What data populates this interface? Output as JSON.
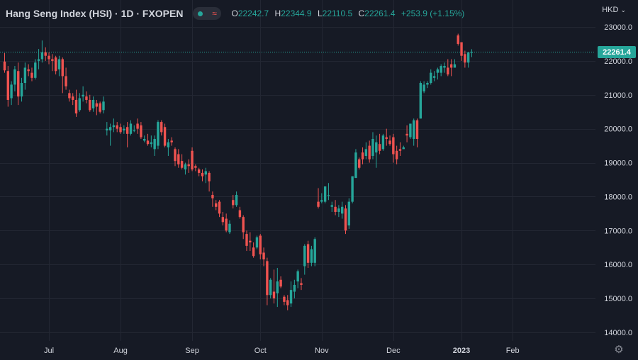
{
  "header": {
    "title": "Hang Seng Index (HSI) · 1D · FXOPEN",
    "ohlc": {
      "open_label": "O",
      "open": "22242.7",
      "high_label": "H",
      "high": "22344.9",
      "low_label": "L",
      "low": "22110.5",
      "close_label": "C",
      "close": "22261.4",
      "change": "+253.9 (+1.15%)"
    },
    "icons": {
      "indicator": "dot-icon",
      "compare": "wave-icon"
    }
  },
  "currency": {
    "label": "HKD",
    "icon": "chevron-down-icon"
  },
  "last_price_tag": "22261.4",
  "settings_icon": "gear-icon",
  "colors": {
    "up": "#26a69a",
    "down": "#ef5350",
    "background": "#161a25",
    "grid": "#232733",
    "axis_text": "#d1d4dc"
  },
  "chart_data": {
    "type": "candlestick",
    "x_ticks": [
      {
        "label": "Jul",
        "index": 13
      },
      {
        "label": "Aug",
        "index": 34
      },
      {
        "label": "Sep",
        "index": 55
      },
      {
        "label": "Oct",
        "index": 75
      },
      {
        "label": "Nov",
        "index": 93
      },
      {
        "label": "Dec",
        "index": 114
      },
      {
        "label": "2023",
        "index": 134
      },
      {
        "label": "Feb",
        "index": 149
      }
    ],
    "y_ticks": [
      14000,
      15000,
      16000,
      17000,
      18000,
      19000,
      20000,
      21000,
      22000,
      23000
    ],
    "ylim": [
      13800,
      23500
    ],
    "last_price": 22261.4,
    "grid": true,
    "candles": [
      [
        21980,
        22230,
        21650,
        21720
      ],
      [
        21700,
        21850,
        20650,
        20850
      ],
      [
        20900,
        21400,
        20700,
        21300
      ],
      [
        21300,
        21850,
        21100,
        21750
      ],
      [
        21700,
        21950,
        20700,
        20950
      ],
      [
        20950,
        21500,
        20800,
        21350
      ],
      [
        21350,
        21950,
        21150,
        21800
      ],
      [
        21750,
        21900,
        21550,
        21700
      ],
      [
        21650,
        21800,
        21400,
        21500
      ],
      [
        21500,
        22050,
        21450,
        21950
      ],
      [
        22000,
        22350,
        21750,
        22050
      ],
      [
        22050,
        22600,
        21950,
        22250
      ],
      [
        22250,
        22400,
        22000,
        22150
      ],
      [
        22150,
        22250,
        21900,
        22050
      ],
      [
        22050,
        22200,
        21700,
        22000
      ],
      [
        22100,
        22150,
        21600,
        21700
      ],
      [
        21750,
        22150,
        21550,
        22050
      ],
      [
        22050,
        22100,
        21050,
        21550
      ],
      [
        21550,
        21800,
        21150,
        21250
      ],
      [
        21050,
        21150,
        20800,
        20900
      ],
      [
        20950,
        21050,
        20700,
        20850
      ],
      [
        20850,
        21150,
        20350,
        20450
      ],
      [
        20550,
        21050,
        20500,
        20900
      ],
      [
        20950,
        21250,
        20800,
        21000
      ],
      [
        20950,
        21100,
        20750,
        20850
      ],
      [
        20850,
        21000,
        20500,
        20550
      ],
      [
        20600,
        20950,
        20500,
        20850
      ],
      [
        20750,
        20850,
        20400,
        20650
      ],
      [
        20750,
        20800,
        20450,
        20500
      ],
      [
        20550,
        20950,
        20450,
        20800
      ],
      [
        19950,
        20200,
        19800,
        20000
      ],
      [
        19950,
        20150,
        19500,
        20050
      ],
      [
        20050,
        20300,
        19900,
        20100
      ],
      [
        20100,
        20200,
        19900,
        20000
      ],
      [
        20050,
        20150,
        19850,
        19900
      ],
      [
        19950,
        20100,
        19850,
        20000
      ],
      [
        20050,
        20200,
        19450,
        19850
      ],
      [
        19850,
        20250,
        19800,
        20150
      ],
      [
        19950,
        20100,
        19900,
        19950
      ],
      [
        20150,
        20300,
        19850,
        20000
      ],
      [
        20100,
        20200,
        19700,
        19750
      ],
      [
        19650,
        19800,
        19600,
        19700
      ],
      [
        19650,
        19850,
        19500,
        19550
      ],
      [
        19550,
        19800,
        19450,
        19600
      ],
      [
        19400,
        19800,
        19200,
        19700
      ],
      [
        19500,
        20250,
        19400,
        20200
      ],
      [
        20200,
        20250,
        19800,
        19900
      ],
      [
        20050,
        20150,
        19450,
        19500
      ],
      [
        19450,
        19700,
        19200,
        19600
      ],
      [
        19650,
        19750,
        19500,
        19600
      ],
      [
        19400,
        19450,
        18900,
        19050
      ],
      [
        19250,
        19400,
        18850,
        18950
      ],
      [
        19050,
        19250,
        18800,
        18850
      ],
      [
        18800,
        19000,
        18650,
        18950
      ],
      [
        18950,
        19100,
        18700,
        18900
      ],
      [
        19350,
        19450,
        18750,
        18800
      ],
      [
        18900,
        18950,
        18750,
        18850
      ],
      [
        18800,
        18850,
        18600,
        18700
      ],
      [
        18700,
        18800,
        18450,
        18600
      ],
      [
        18650,
        18850,
        18400,
        18750
      ],
      [
        18700,
        18750,
        18150,
        18450
      ],
      [
        18050,
        18150,
        17700,
        17950
      ],
      [
        17800,
        17900,
        17600,
        17700
      ],
      [
        17850,
        17900,
        17400,
        17500
      ],
      [
        17400,
        17550,
        17150,
        17250
      ],
      [
        17350,
        17500,
        16950,
        17000
      ],
      [
        16950,
        17300,
        16900,
        17200
      ],
      [
        17900,
        18050,
        17650,
        17750
      ],
      [
        17750,
        18150,
        17700,
        18050
      ],
      [
        17600,
        17700,
        17350,
        17400
      ],
      [
        17400,
        17450,
        16750,
        16950
      ],
      [
        16900,
        17000,
        16400,
        16550
      ],
      [
        16700,
        16950,
        16400,
        16650
      ],
      [
        16500,
        16650,
        16200,
        16250
      ],
      [
        16500,
        16850,
        16450,
        16800
      ],
      [
        16850,
        16900,
        16150,
        16300
      ],
      [
        16350,
        16500,
        15950,
        16150
      ],
      [
        16100,
        16200,
        14800,
        15100
      ],
      [
        15100,
        15600,
        15000,
        15550
      ],
      [
        15200,
        15850,
        14850,
        15000
      ],
      [
        15150,
        15900,
        14750,
        15500
      ],
      [
        15550,
        15650,
        15300,
        15350
      ],
      [
        15050,
        15100,
        14800,
        14900
      ],
      [
        14950,
        15100,
        14650,
        14800
      ],
      [
        14850,
        15500,
        14750,
        15250
      ],
      [
        15200,
        15550,
        15000,
        15400
      ],
      [
        15500,
        15850,
        15300,
        15800
      ],
      [
        15450,
        15600,
        15250,
        15400
      ],
      [
        15950,
        16600,
        15700,
        16550
      ],
      [
        16600,
        16700,
        15900,
        16050
      ],
      [
        16050,
        16550,
        15950,
        16450
      ],
      [
        16050,
        16800,
        15950,
        16750
      ],
      [
        17850,
        18250,
        17650,
        17700
      ],
      [
        17850,
        18100,
        17800,
        17900
      ],
      [
        17850,
        18300,
        17800,
        18300
      ],
      [
        18050,
        18400,
        17900,
        18050
      ],
      [
        17700,
        17850,
        17550,
        17750
      ],
      [
        17700,
        17900,
        17450,
        17550
      ],
      [
        17550,
        17750,
        17400,
        17650
      ],
      [
        17500,
        17850,
        17350,
        17700
      ],
      [
        17650,
        17750,
        16900,
        17000
      ],
      [
        17150,
        17950,
        17050,
        17850
      ],
      [
        17850,
        18600,
        17800,
        18600
      ],
      [
        18550,
        19400,
        18550,
        19300
      ],
      [
        19100,
        19150,
        18800,
        18850
      ],
      [
        19300,
        19450,
        18950,
        19100
      ],
      [
        19200,
        19600,
        19100,
        19400
      ],
      [
        19500,
        19650,
        19000,
        19100
      ],
      [
        19200,
        19900,
        19100,
        19700
      ],
      [
        19300,
        19800,
        18850,
        19600
      ],
      [
        19550,
        19850,
        19250,
        19350
      ],
      [
        19400,
        19850,
        19350,
        19800
      ],
      [
        19750,
        20000,
        19500,
        19700
      ],
      [
        19650,
        19800,
        19500,
        19550
      ],
      [
        19750,
        19850,
        19000,
        19250
      ],
      [
        19350,
        19500,
        18950,
        19100
      ],
      [
        19400,
        19600,
        19200,
        19350
      ],
      [
        19400,
        19500,
        19400,
        19450
      ],
      [
        19850,
        20100,
        19600,
        19800
      ],
      [
        19750,
        20150,
        19700,
        20150
      ],
      [
        19700,
        20300,
        19500,
        20250
      ],
      [
        20250,
        20300,
        19450,
        19700
      ],
      [
        20300,
        21400,
        20300,
        21350
      ],
      [
        21100,
        21400,
        21050,
        21300
      ],
      [
        21300,
        21400,
        21200,
        21350
      ],
      [
        21350,
        21750,
        21300,
        21650
      ],
      [
        21500,
        21700,
        21400,
        21550
      ],
      [
        21650,
        21800,
        21450,
        21750
      ],
      [
        21650,
        21900,
        21550,
        21850
      ],
      [
        21800,
        21950,
        21650,
        21850
      ],
      [
        21800,
        22050,
        21550,
        21600
      ],
      [
        21900,
        22050,
        21550,
        21800
      ],
      [
        21800,
        22050,
        21800,
        21900
      ],
      [
        22750,
        22800,
        22450,
        22500
      ],
      [
        22550,
        22550,
        22000,
        22150
      ],
      [
        22200,
        22300,
        21800,
        21950
      ],
      [
        21950,
        22200,
        21800,
        22250
      ],
      [
        22242.7,
        22344.9,
        22110.5,
        22261.4
      ]
    ]
  }
}
